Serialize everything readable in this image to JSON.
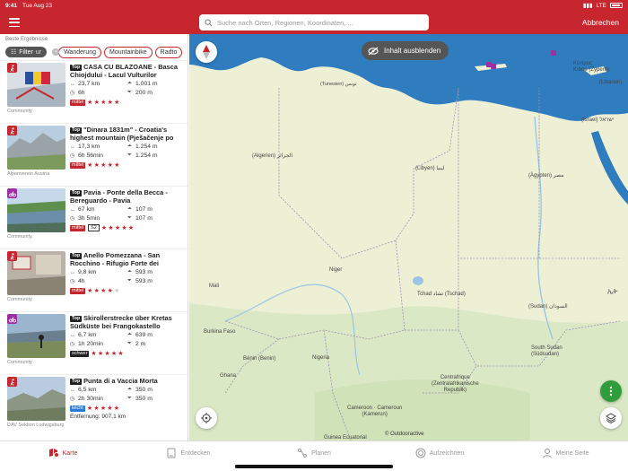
{
  "status": {
    "time": "9:41",
    "date": "Tue Aug 23",
    "network": "LTE",
    "battery": "100%"
  },
  "search": {
    "placeholder": "Suche nach Orten, Regionen, Koordinaten, ..."
  },
  "header": {
    "cancel_label": "Abbrechen"
  },
  "sidebar": {
    "heading": "Beste Ergebnisse",
    "filter_label": "Filter",
    "filter_hidden_text": "ur",
    "chips": [
      "Wanderung",
      "Mountainbike",
      "Radto"
    ],
    "tours": [
      {
        "category": "hike",
        "title": "CASA CU BLAZOANE - Basca Chiojdului - Lacul Vulturilor",
        "top": "Top",
        "distance": "23,7 km",
        "ascent": "1.001 m",
        "duration": "6h",
        "descent": "200 m",
        "difficulty": "mittel",
        "grade": "",
        "stars": 5,
        "author": "Community",
        "note": ""
      },
      {
        "category": "hike",
        "title": "\"Dinara 1831m\" - Croatia's highest mountain (Pješačenje po",
        "top": "Top",
        "distance": "17,3 km",
        "ascent": "1.254 m",
        "duration": "6h 56min",
        "descent": "1.254 m",
        "difficulty": "mittel",
        "grade": "",
        "stars": 5,
        "author": "Alpenverein Austria",
        "note": ""
      },
      {
        "category": "bike",
        "title": "Pavia - Ponte della Becca - Bereguardo - Pavia",
        "top": "Top",
        "distance": "67 km",
        "ascent": "107 m",
        "duration": "3h 5min",
        "descent": "107 m",
        "difficulty": "mittel",
        "grade": "S2",
        "stars": 5,
        "author": "Community",
        "note": ""
      },
      {
        "category": "hike",
        "title": "Anello Pomezzana - San Rocchino - Rifugio Forte dei",
        "top": "Top",
        "distance": "9,8 km",
        "ascent": "593 m",
        "duration": "4h",
        "descent": "593 m",
        "difficulty": "mittel",
        "grade": "",
        "stars": 4,
        "author": "Community",
        "note": ""
      },
      {
        "category": "bike",
        "title": "Skirollerstrecke über Kretas Südküste bei Frangokastello",
        "top": "Top",
        "distance": "6,7 km",
        "ascent": "639 m",
        "duration": "1h 20min",
        "descent": "2 m",
        "difficulty": "schwer",
        "grade": "",
        "stars": 5,
        "author": "Community",
        "note": ""
      },
      {
        "category": "hike",
        "title": "Punta di a Vaccia Morta",
        "top": "Top",
        "distance": "6,5 km",
        "ascent": "350 m",
        "duration": "2h 30min",
        "descent": "350 m",
        "difficulty": "leicht",
        "grade": "",
        "stars": 5,
        "author": "DAV Sektion Ludwigsburg",
        "note": "Entfernung: 907,1 km"
      }
    ]
  },
  "map": {
    "hide_content_label": "Inhalt ausblenden",
    "attribution": "© Outdooractive",
    "labels": {
      "tunisia": "(Tunesien) تونس",
      "algeria": "(Algerien) الجزائر",
      "libya": "(Libyen) ليبيا",
      "egypt": "(Ägypten) مصر",
      "cyprus": "Κύπρος\nKıbrıs (Zypern)",
      "lebanon": "(Libanon)",
      "israel": "(Israel) ישראל",
      "niger": "Niger",
      "mali": "Mali",
      "chad": "Tchad تشاد (Tschad)",
      "sudan": "(Sudan) السودان",
      "burkina": "Burkina Faso",
      "ghana": "Ghana",
      "benin": "Bénin (Benin)",
      "nigeria": "Nigeria",
      "car": "Centrafrique\n(Zentralafrikanische\nRepublik)",
      "south_sudan": "South Sudan\n(Südsudan)",
      "cameroon": "Cameroon · Cameroun\n(Kamerun)",
      "guinea": "Guinea Ecuatorial",
      "ethiopia": "ኢት"
    }
  },
  "tabs": [
    {
      "label": "Karte",
      "icon": "map-icon",
      "active": true
    },
    {
      "label": "Entdecken",
      "icon": "discover-icon",
      "active": false
    },
    {
      "label": "Planen",
      "icon": "route-plan-icon",
      "active": false
    },
    {
      "label": "Aufzeichnen",
      "icon": "record-icon",
      "active": false
    },
    {
      "label": "Meine Seite",
      "icon": "profile-icon",
      "active": false
    }
  ],
  "colors": {
    "brand": "#c8262e",
    "sea": "#2f7dbf",
    "land": "#eef0d6",
    "green_action": "#2e9d3a"
  }
}
